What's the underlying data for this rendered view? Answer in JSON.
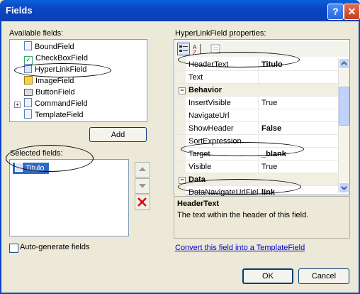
{
  "window": {
    "title": "Fields",
    "help_glyph": "?",
    "close_glyph": "✕"
  },
  "available": {
    "label": "Available fields:",
    "items": [
      {
        "label": "BoundField",
        "icon": "boundfield-icon"
      },
      {
        "label": "CheckBoxField",
        "icon": "checkboxfield-icon"
      },
      {
        "label": "HyperLinkField",
        "icon": "hyperlinkfield-icon"
      },
      {
        "label": "ImageField",
        "icon": "imagefield-icon"
      },
      {
        "label": "ButtonField",
        "icon": "buttonfield-icon"
      },
      {
        "label": "CommandField",
        "icon": "commandfield-icon",
        "expandable": true
      },
      {
        "label": "TemplateField",
        "icon": "templatefield-icon"
      }
    ],
    "expand_glyph": "+",
    "add_label": "Add"
  },
  "selected": {
    "label": "Selected fields:",
    "items": [
      {
        "label": "Titulo"
      }
    ]
  },
  "autogen": {
    "label": "Auto-generate fields",
    "checked": false
  },
  "properties": {
    "label": "HyperLinkField properties:",
    "rows": [
      {
        "type": "prop",
        "name": "HeaderText",
        "value": "Titulo",
        "bold": true
      },
      {
        "type": "prop",
        "name": "Text",
        "value": "",
        "bold": false
      },
      {
        "type": "cat",
        "name": "Behavior"
      },
      {
        "type": "prop",
        "name": "InsertVisible",
        "value": "True",
        "bold": false
      },
      {
        "type": "prop",
        "name": "NavigateUrl",
        "value": "",
        "bold": false
      },
      {
        "type": "prop",
        "name": "ShowHeader",
        "value": "False",
        "bold": true
      },
      {
        "type": "prop",
        "name": "SortExpression",
        "value": "",
        "bold": false
      },
      {
        "type": "prop",
        "name": "Target",
        "value": "_blank",
        "bold": true
      },
      {
        "type": "prop",
        "name": "Visible",
        "value": "True",
        "bold": false
      },
      {
        "type": "cat",
        "name": "Data"
      },
      {
        "type": "prop",
        "name": "DataNavigateUrlFiel",
        "value": "link",
        "bold": true
      }
    ],
    "collapse_glyph": "−"
  },
  "description": {
    "title": "HeaderText",
    "text": "The text within the header of this field."
  },
  "convert_link": "Convert this field into a TemplateField",
  "buttons": {
    "ok": "OK",
    "cancel": "Cancel"
  },
  "colors": {
    "titlebar": "#0a46c4",
    "selection": "#316ac5",
    "link": "#0000cc"
  }
}
